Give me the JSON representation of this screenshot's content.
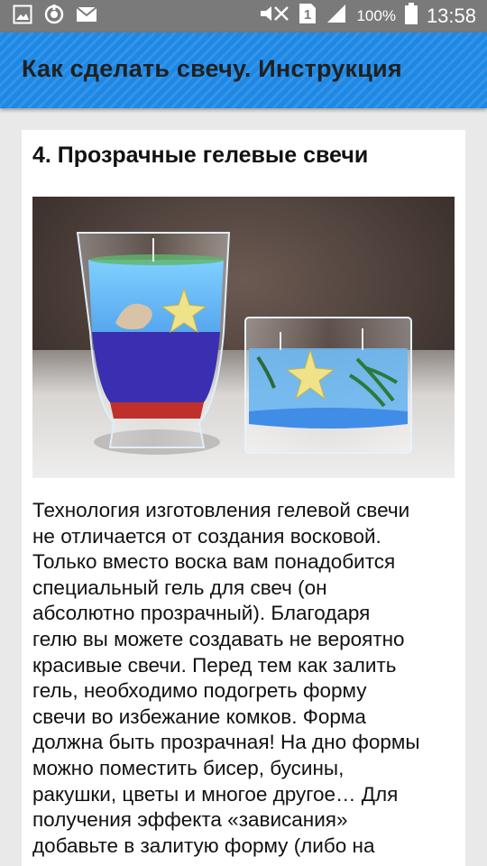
{
  "status_bar": {
    "battery_percent": "100%",
    "time": "13:58",
    "sim_slot": "1",
    "icons": [
      "image-icon",
      "sync-icon",
      "mail-icon",
      "mute-icon",
      "sim-icon",
      "signal-icon",
      "battery-icon"
    ]
  },
  "app_bar": {
    "title": "Как сделать свечу. Инструкция",
    "color": "#1e88e5"
  },
  "article": {
    "heading": "4. Прозрачные гелевые свечи",
    "image_description": "gel-candles-photo",
    "body": "Технология изготовления гелевой свечи\nне отличается от создания восковой.\nТолько вместо воска вам понадобится\nспециальный гель для свеч (он\nабсолютно прозрачный). Благодаря\nгелю вы можете создавать не вероятно\nкрасивые свечи. Перед тем как залить\nгель, необходимо подогреть форму\nсвечи во избежание комков. Форма\nдолжна быть прозрачная! На дно формы\nможно поместить бисер, бусины,\nракушки, цветы и многое другое… Для\nполучения эффекта «зависания»\nдобавьте в залитую форму (либо на"
  }
}
